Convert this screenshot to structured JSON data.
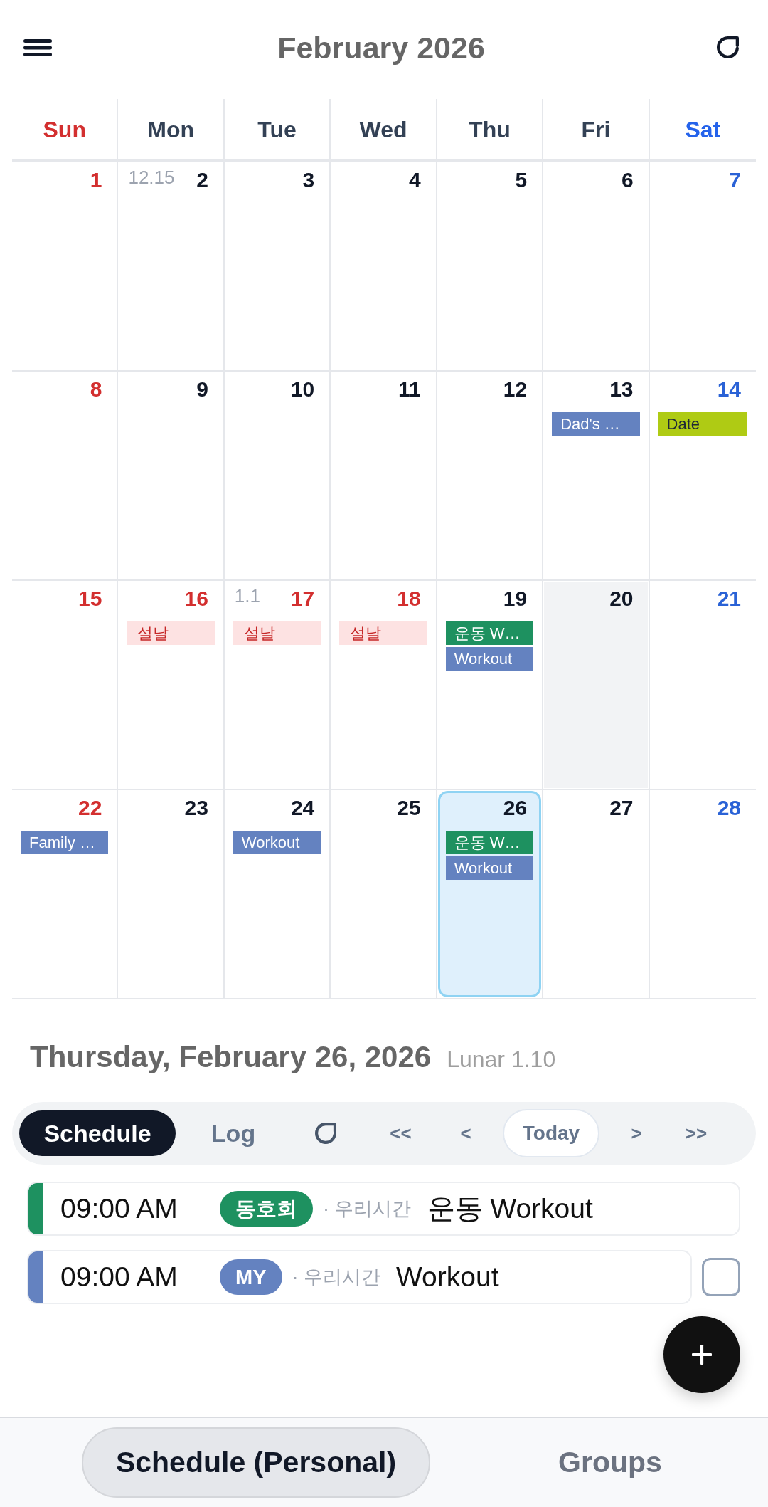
{
  "header": {
    "title": "February 2026"
  },
  "calendar": {
    "weekdays": [
      "Sun",
      "Mon",
      "Tue",
      "Wed",
      "Thu",
      "Fri",
      "Sat"
    ],
    "weeks": [
      [
        {
          "day": "1",
          "holiday": true,
          "shaded": false,
          "selected": false
        },
        {
          "day": "2",
          "lunar": "12.15",
          "holiday": false,
          "shaded": false,
          "selected": false
        },
        {
          "day": "3",
          "holiday": false,
          "shaded": false,
          "selected": false
        },
        {
          "day": "4",
          "holiday": false,
          "shaded": false,
          "selected": false
        },
        {
          "day": "5",
          "holiday": false,
          "shaded": false,
          "selected": false
        },
        {
          "day": "6",
          "holiday": false,
          "shaded": false,
          "selected": false
        },
        {
          "day": "7",
          "holiday": false,
          "shaded": false,
          "selected": false
        }
      ],
      [
        {
          "day": "8",
          "holiday": true,
          "shaded": false,
          "selected": false
        },
        {
          "day": "9",
          "holiday": false,
          "shaded": false,
          "selected": false
        },
        {
          "day": "10",
          "holiday": false,
          "shaded": false,
          "selected": false
        },
        {
          "day": "11",
          "holiday": false,
          "shaded": false,
          "selected": false
        },
        {
          "day": "12",
          "holiday": false,
          "shaded": false,
          "selected": false
        },
        {
          "day": "13",
          "holiday": false,
          "shaded": false,
          "selected": false,
          "events": [
            {
              "kind": "event",
              "text": "Dad's …",
              "color": "#6482c0"
            }
          ]
        },
        {
          "day": "14",
          "holiday": false,
          "shaded": false,
          "selected": false,
          "events": [
            {
              "kind": "event",
              "text": "Date",
              "color": "#afcb14"
            }
          ]
        }
      ],
      [
        {
          "day": "15",
          "holiday": true,
          "shaded": false,
          "selected": false
        },
        {
          "day": "16",
          "holiday": true,
          "shaded": false,
          "selected": false,
          "events": [
            {
              "kind": "holiday",
              "text": "설날"
            }
          ]
        },
        {
          "day": "17",
          "lunar": "1.1",
          "holiday": true,
          "shaded": false,
          "selected": false,
          "events": [
            {
              "kind": "holiday",
              "text": "설날"
            }
          ]
        },
        {
          "day": "18",
          "holiday": true,
          "shaded": false,
          "selected": false,
          "events": [
            {
              "kind": "holiday",
              "text": "설날"
            }
          ]
        },
        {
          "day": "19",
          "holiday": false,
          "shaded": false,
          "selected": false,
          "events": [
            {
              "kind": "event",
              "text": "운동 W…",
              "color": "#1e9160"
            },
            {
              "kind": "event",
              "text": "Workout",
              "color": "#6482c0"
            }
          ]
        },
        {
          "day": "20",
          "holiday": false,
          "shaded": true,
          "selected": false
        },
        {
          "day": "21",
          "holiday": false,
          "shaded": false,
          "selected": false
        }
      ],
      [
        {
          "day": "22",
          "holiday": true,
          "shaded": false,
          "selected": false,
          "events": [
            {
              "kind": "event",
              "text": "Family …",
              "color": "#6482c0"
            }
          ]
        },
        {
          "day": "23",
          "holiday": false,
          "shaded": false,
          "selected": false
        },
        {
          "day": "24",
          "holiday": false,
          "shaded": false,
          "selected": false,
          "events": [
            {
              "kind": "event",
              "text": "Workout",
              "color": "#6482c0"
            }
          ]
        },
        {
          "day": "25",
          "holiday": false,
          "shaded": false,
          "selected": false
        },
        {
          "day": "26",
          "holiday": false,
          "shaded": false,
          "selected": true,
          "events": [
            {
              "kind": "event",
              "text": "운동 W…",
              "color": "#1e9160"
            },
            {
              "kind": "event",
              "text": "Workout",
              "color": "#6482c0"
            }
          ]
        },
        {
          "day": "27",
          "holiday": false,
          "shaded": false,
          "selected": false
        },
        {
          "day": "28",
          "holiday": false,
          "shaded": false,
          "selected": false
        }
      ]
    ]
  },
  "day_detail": {
    "date": "Thursday, February 26, 2026",
    "lunar": "Lunar 1.10"
  },
  "toolbar": {
    "tabs": [
      {
        "label": "Schedule",
        "selected": true
      },
      {
        "label": "Log",
        "selected": false
      }
    ],
    "nav": [
      {
        "label": "<<",
        "kind": "step"
      },
      {
        "label": "<",
        "kind": "step"
      },
      {
        "label": "Today",
        "kind": "today"
      },
      {
        "label": ">",
        "kind": "step"
      },
      {
        "label": ">>",
        "kind": "step"
      }
    ]
  },
  "schedule": [
    {
      "kind": "plain",
      "color": "#1e9160",
      "time": "09:00 AM",
      "group": "동호회",
      "calendar": "· 우리시간",
      "title": "운동 Workout"
    },
    {
      "kind": "checkable",
      "checked": false,
      "color": "#6482c0",
      "time": "09:00 AM",
      "group": "MY",
      "calendar": "· 우리시간",
      "title": "Workout"
    }
  ],
  "bottom_nav": [
    {
      "label": "Schedule (Personal)",
      "selected": true
    },
    {
      "label": "Groups",
      "selected": false
    }
  ]
}
